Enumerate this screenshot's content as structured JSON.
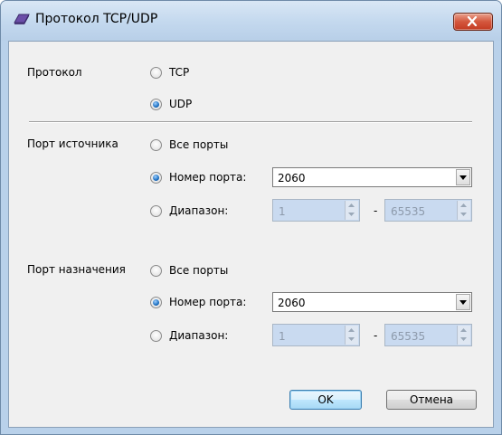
{
  "window": {
    "title": "Протокол TCP/UDP",
    "close_icon": "close-icon"
  },
  "protocol": {
    "label": "Протокол",
    "options": [
      {
        "label": "TCP",
        "checked": false
      },
      {
        "label": "UDP",
        "checked": true
      }
    ]
  },
  "source_port": {
    "label": "Порт источника",
    "all_ports_label": "Все порты",
    "port_number_label": "Номер порта:",
    "port_number_value": "2060",
    "range_label": "Диапазон:",
    "range_from": "1",
    "range_separator": "-",
    "range_to": "65535",
    "selected": "port_number"
  },
  "dest_port": {
    "label": "Порт назначения",
    "all_ports_label": "Все порты",
    "port_number_label": "Номер порта:",
    "port_number_value": "2060",
    "range_label": "Диапазон:",
    "range_from": "1",
    "range_separator": "-",
    "range_to": "65535",
    "selected": "port_number"
  },
  "buttons": {
    "ok": "OK",
    "cancel": "Отмена"
  },
  "colors": {
    "title_bar": "#c3d8ee",
    "dialog_bg": "#f0f0f0",
    "close_button": "#c43b22",
    "disabled_field": "#c9daf0"
  }
}
